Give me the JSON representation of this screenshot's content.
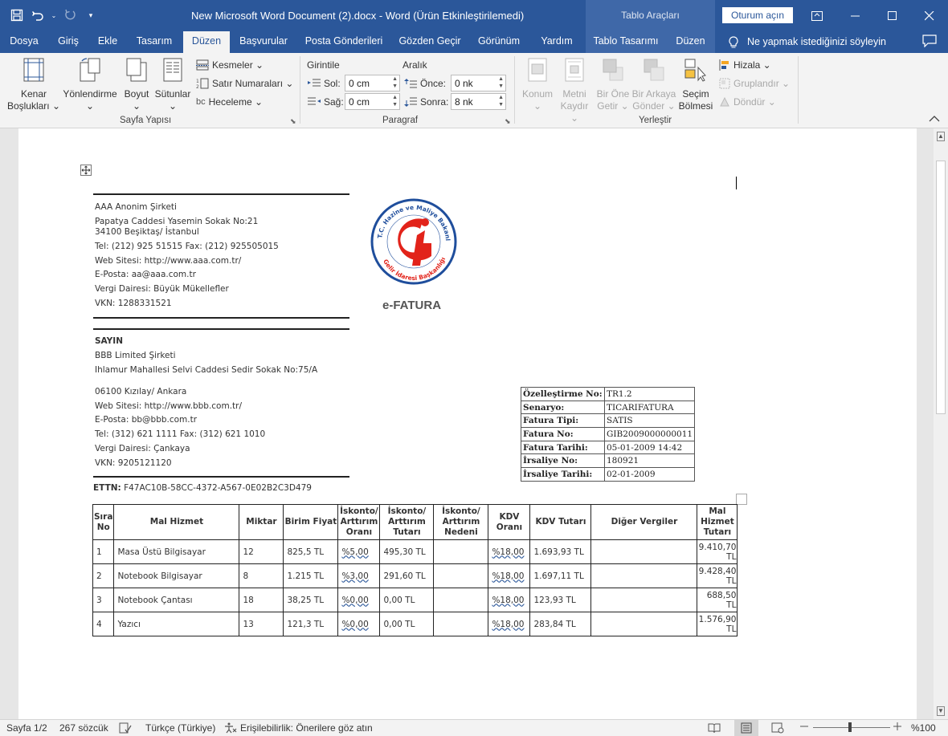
{
  "window": {
    "title": "New Microsoft Word Document (2).docx  -  Word (Ürün Etkinleştirilemedi)",
    "context_title": "Tablo Araçları",
    "signin_label": "Oturum açın"
  },
  "tabs": [
    "Dosya",
    "Giriş",
    "Ekle",
    "Tasarım",
    "Düzen",
    "Başvurular",
    "Posta Gönderileri",
    "Gözden Geçir",
    "Görünüm",
    "Yardım",
    "Tablo Tasarımı",
    "Düzen"
  ],
  "active_tab": "Düzen",
  "tell_me": "Ne yapmak istediğinizi söyleyin",
  "ribbon": {
    "page_setup": {
      "margins": [
        "Kenar",
        "Boşlukları ⌄"
      ],
      "orientation": [
        "Yönlendirme",
        "⌄"
      ],
      "size": [
        "Boyut",
        "⌄"
      ],
      "columns": [
        "Sütunlar",
        "⌄"
      ],
      "breaks": "Kesmeler ⌄",
      "line_numbers": "Satır Numaraları ⌄",
      "hyphenation": "Heceleme ⌄",
      "label": "Sayfa Yapısı"
    },
    "paragraph": {
      "indent_title": "Girintile",
      "spacing_title": "Aralık",
      "left_label": "Sol:",
      "left_value": "0 cm",
      "right_label": "Sağ:",
      "right_value": "0 cm",
      "before_label": "Önce:",
      "before_value": "0 nk",
      "after_label": "Sonra:",
      "after_value": "8 nk",
      "label": "Paragraf"
    },
    "arrange": {
      "position": [
        "Konum",
        "⌄"
      ],
      "wrap": [
        "Metni",
        "Kaydır ⌄"
      ],
      "forward": [
        "Bir Öne",
        "Getir ⌄"
      ],
      "backward": [
        "Bir Arkaya",
        "Gönder ⌄"
      ],
      "selection": [
        "Seçim",
        "Bölmesi"
      ],
      "align": "Hizala ⌄",
      "group": "Gruplandır ⌄",
      "rotate": "Döndür ⌄",
      "label": "Yerleştir"
    }
  },
  "document": {
    "sender": [
      "AAA Anonim Şirketi",
      "Papatya Caddesi Yasemin Sokak  No:21",
      "34100 Beşiktaş/ İstanbul",
      "Tel: (212) 925 51515 Fax: (212) 925505015",
      "Web Sitesi: http://www.aaa.com.tr/",
      "E-Posta: aa@aaa.com.tr",
      "Vergi Dairesi: Büyük Mükellefler",
      "VKN: 1288331521"
    ],
    "logo": {
      "top_text": "T.C. Hazine ve Maliye Bakanlığı",
      "bottom_text": "Gelir İdaresi Başkanlığı"
    },
    "efatura": "e-FATURA",
    "buyer_heading": "SAYIN",
    "buyer": [
      "BBB Limited Şirketi",
      "Ihlamur Mahallesi Selvi Caddesi Sedir Sokak  No:75/A",
      "06100 Kızılay/ Ankara",
      "Web Sitesi: http://www.bbb.com.tr/",
      "E-Posta: bb@bbb.com.tr",
      "Tel: (312) 621 1111 Fax: (312) 621 1010",
      "Vergi Dairesi: Çankaya",
      "VKN: 9205121120"
    ],
    "ettn_label": "ETTN:",
    "ettn_value": "F47AC10B-58CC-4372-A567-0E02B2C3D479",
    "info": [
      [
        "Özelleştirme No:",
        "TR1.2"
      ],
      [
        "Senaryo:",
        "TICARIFATURA"
      ],
      [
        "Fatura Tipi:",
        "SATIS"
      ],
      [
        "Fatura No:",
        "GIB2009000000011"
      ],
      [
        "Fatura Tarihi:",
        "05-01-2009 14:42"
      ],
      [
        "İrsaliye No:",
        "180921"
      ],
      [
        "İrsaliye Tarihi:",
        "02-01-2009"
      ]
    ],
    "items_headers": [
      "Sıra No",
      "Mal Hizmet",
      "Miktar",
      "Birim Fiyat",
      "İskonto/ Arttırım Oranı",
      "İskonto/ Arttırım Tutarı",
      "İskonto/ Arttırım Nedeni",
      "KDV Oranı",
      "KDV Tutarı",
      "Diğer Vergiler",
      "Mal Hizmet Tutarı"
    ],
    "items": [
      [
        "1",
        "Masa Üstü Bilgisayar",
        "12",
        "825,5 TL",
        "%5,00",
        "495,30 TL",
        "",
        "%18,00",
        "1.693,93 TL",
        "",
        "9.410,70 TL"
      ],
      [
        "2",
        "Notebook Bilgisayar",
        "8",
        "1.215 TL",
        "%3,00",
        "291,60 TL",
        "",
        "%18,00",
        "1.697,11 TL",
        "",
        "9.428,40 TL"
      ],
      [
        "3",
        "Notebook Çantası",
        "18",
        "38,25 TL",
        "%0,00",
        "0,00 TL",
        "",
        "%18,00",
        "123,93 TL",
        "",
        "688,50 TL"
      ],
      [
        "4",
        "Yazıcı",
        "13",
        "121,3 TL",
        "%0,00",
        "0,00 TL",
        "",
        "%18,00",
        "283,84 TL",
        "",
        "1.576,90 TL"
      ]
    ]
  },
  "status": {
    "page": "Sayfa 1/2",
    "words": "267 sözcük",
    "language": "Türkçe (Türkiye)",
    "accessibility": "Erişilebilirlik: Önerilere göz atın",
    "zoom": "%100"
  },
  "colors": {
    "word_blue": "#2b579a",
    "context_blue": "#3f68a8",
    "logo_red": "#e2231a",
    "logo_blue": "#1f4e9c"
  }
}
